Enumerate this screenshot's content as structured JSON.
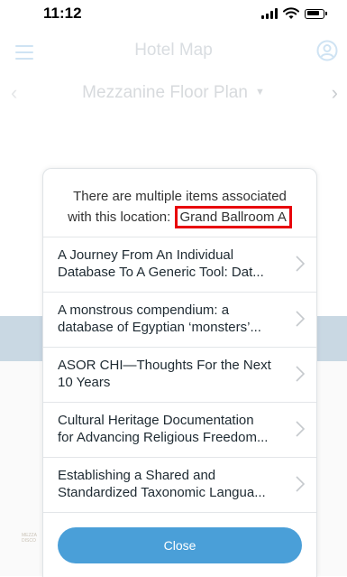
{
  "status_bar": {
    "time": "11:12"
  },
  "header": {
    "title": "Hotel Map"
  },
  "floor": {
    "title": "Mezzanine Floor Plan"
  },
  "map": {
    "faint_label_1": "MEZZA",
    "faint_label_2": "DISCO"
  },
  "modal": {
    "message_line1": "There are multiple items associated",
    "message_line2": "with this location:",
    "location_name": "Grand Ballroom A",
    "items": [
      {
        "line1": "A Journey From An Individual",
        "line2": "Database To A Generic Tool: Dat..."
      },
      {
        "line1": "A monstrous compendium: a",
        "line2": "database of Egyptian ‘monsters’..."
      },
      {
        "line1": "ASOR CHI—Thoughts For the Next",
        "line2": "10 Years"
      },
      {
        "line1": "Cultural Heritage Documentation",
        "line2": "for Advancing Religious Freedom..."
      },
      {
        "line1": "Establishing a Shared and",
        "line2": "Standardized Taxonomic Langua..."
      }
    ],
    "close_label": "Close"
  },
  "colors": {
    "accent": "#4a9fd8",
    "highlight_border": "#e8000a",
    "map_band": "#c9d8e3"
  },
  "icons": [
    "menu-icon",
    "account-icon",
    "chevron-left-icon",
    "chevron-right-icon",
    "caret-down-icon",
    "chevron-right-icon"
  ]
}
